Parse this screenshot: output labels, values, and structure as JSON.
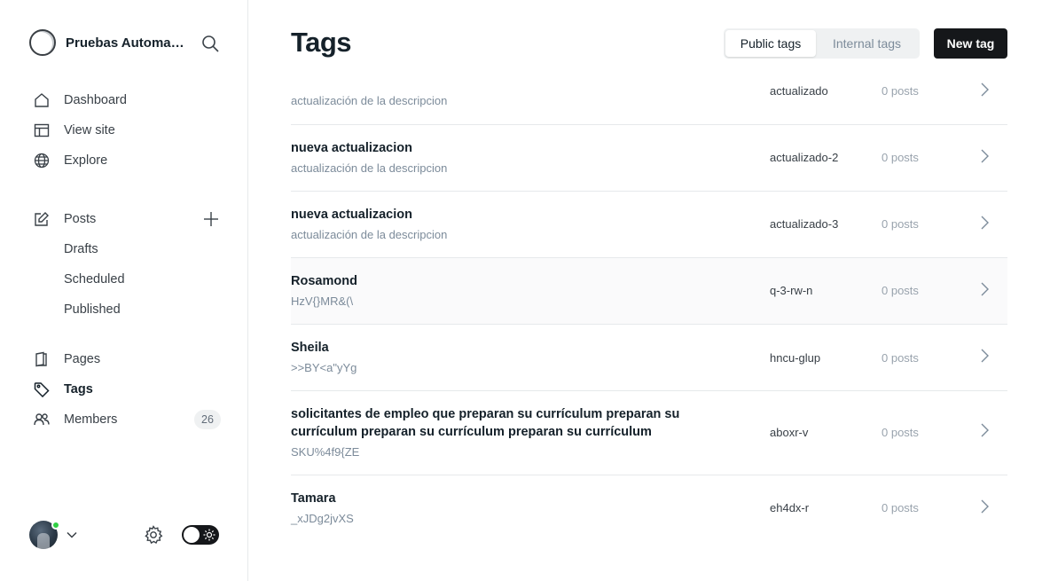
{
  "sidebar": {
    "site_name": "Pruebas Automatizadas",
    "nav": [
      {
        "label": "Dashboard",
        "icon": "home-icon"
      },
      {
        "label": "View site",
        "icon": "layout-icon"
      },
      {
        "label": "Explore",
        "icon": "globe-icon"
      }
    ],
    "posts": {
      "label": "Posts",
      "icon": "edit-icon",
      "sub": [
        "Drafts",
        "Scheduled",
        "Published"
      ]
    },
    "nav2": [
      {
        "label": "Pages",
        "icon": "page-icon"
      },
      {
        "label": "Tags",
        "icon": "tag-icon"
      },
      {
        "label": "Members",
        "icon": "members-icon",
        "count": "26"
      }
    ]
  },
  "header": {
    "title": "Tags",
    "tabs": [
      "Public tags",
      "Internal tags"
    ],
    "active_tab": "Public tags",
    "new_button": "New tag"
  },
  "tags": [
    {
      "name": "",
      "description": "actualización de la descripcion",
      "slug": "actualizado",
      "count": "0 posts"
    },
    {
      "name": "nueva actualizacion",
      "description": "actualización de la descripcion",
      "slug": "actualizado-2",
      "count": "0 posts"
    },
    {
      "name": "nueva actualizacion",
      "description": "actualización de la descripcion",
      "slug": "actualizado-3",
      "count": "0 posts"
    },
    {
      "name": "Rosamond",
      "description": "HzV{}MR&(\\",
      "slug": "q-3-rw-n",
      "count": "0 posts"
    },
    {
      "name": "Sheila",
      "description": ">>BY<a\"yYg",
      "slug": "hncu-glup",
      "count": "0 posts"
    },
    {
      "name": "solicitantes de empleo que preparan su currículum preparan su currículum preparan su currículum preparan su currículum",
      "description": "SKU%4f9{ZE",
      "slug": "aboxr-v",
      "count": "0 posts"
    },
    {
      "name": "Tamara",
      "description": "_xJDg2jvXS",
      "slug": "eh4dx-r",
      "count": "0 posts"
    }
  ],
  "colors": {
    "accent": "#15171a",
    "online": "#30cf43",
    "muted": "#7c8b9a"
  }
}
